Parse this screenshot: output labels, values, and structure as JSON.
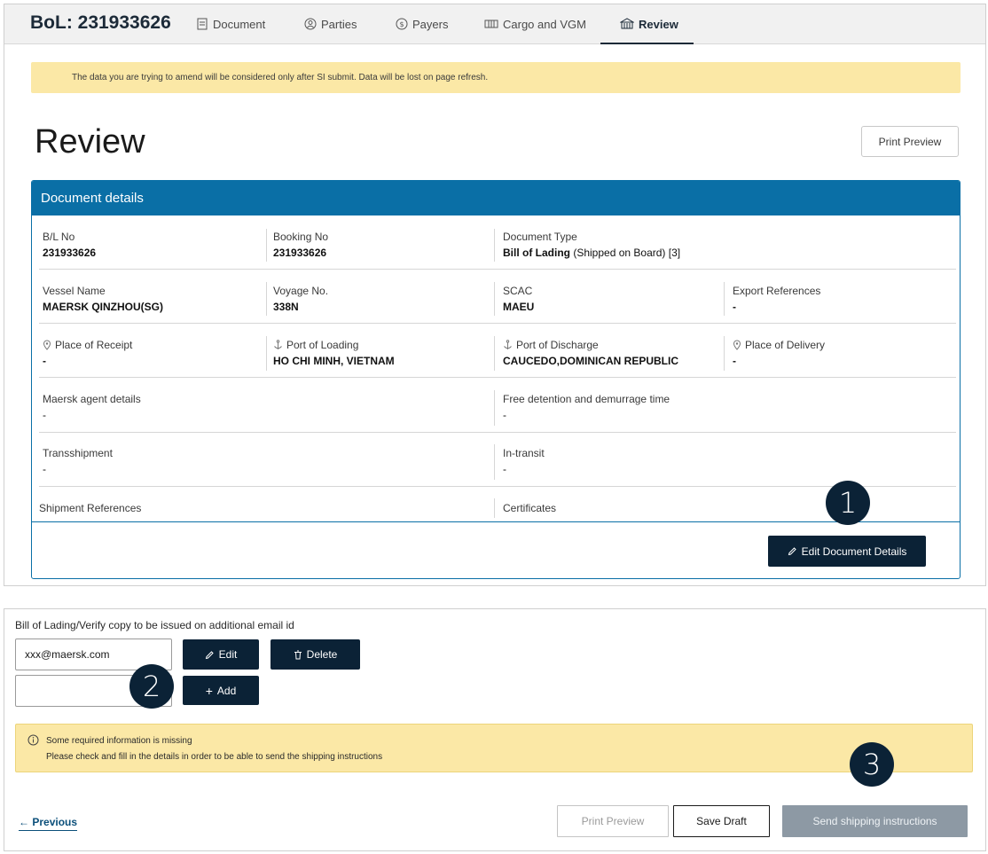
{
  "header": {
    "bol_title": "BoL: 231933626",
    "tabs": [
      {
        "label": "Document",
        "icon": "document-icon"
      },
      {
        "label": "Parties",
        "icon": "user-circle-icon"
      },
      {
        "label": "Payers",
        "icon": "dollar-circle-icon"
      },
      {
        "label": "Cargo and VGM",
        "icon": "container-icon"
      },
      {
        "label": "Review",
        "icon": "building-icon",
        "active": true
      }
    ]
  },
  "banner": {
    "text": "The data you are trying to amend will be considered only after SI submit. Data will be lost on page refresh."
  },
  "page": {
    "title": "Review",
    "print_preview_label": "Print Preview"
  },
  "document_details": {
    "heading": "Document details",
    "bl_no": {
      "label": "B/L No",
      "value": "231933626"
    },
    "booking_no": {
      "label": "Booking No",
      "value": "231933626"
    },
    "document_type": {
      "label": "Document Type",
      "value_bold": "Bill of Lading",
      "value_rest": " (Shipped on Board) [3]"
    },
    "vessel_name": {
      "label": "Vessel Name",
      "value": "MAERSK QINZHOU(SG)"
    },
    "voyage_no": {
      "label": "Voyage No.",
      "value": "338N"
    },
    "scac": {
      "label": "SCAC",
      "value": "MAEU"
    },
    "export_references": {
      "label": "Export References",
      "value": "-"
    },
    "place_of_receipt": {
      "label": "Place of Receipt",
      "value": "-"
    },
    "port_of_loading": {
      "label": "Port of Loading",
      "value": "HO CHI MINH, VIETNAM"
    },
    "port_of_discharge": {
      "label": "Port of Discharge",
      "value": "CAUCEDO,DOMINICAN REPUBLIC"
    },
    "place_of_delivery": {
      "label": "Place of Delivery",
      "value": "-"
    },
    "agent_details": {
      "label": "Maersk agent details",
      "value": "-"
    },
    "free_detention": {
      "label": "Free detention and demurrage time",
      "value": "-"
    },
    "transshipment": {
      "label": "Transshipment",
      "value": "-"
    },
    "in_transit": {
      "label": "In-transit",
      "value": "-"
    },
    "shipment_references": {
      "label": "Shipment References"
    },
    "certificates": {
      "label": "Certificates"
    },
    "edit_button_label": "Edit Document Details"
  },
  "email_section": {
    "label": "Bill of Lading/Verify copy to be issued on additional email id",
    "email_value": "xxx@maersk.com",
    "new_email_value": "",
    "edit_label": "Edit",
    "delete_label": "Delete",
    "add_label": "Add"
  },
  "warning": {
    "line1": "Some required information is missing",
    "line2": "Please check and fill in the details in order to be able to send the shipping instructions"
  },
  "footer": {
    "previous_label": "Previous",
    "print_preview_label": "Print Preview",
    "save_draft_label": "Save Draft",
    "send_label": "Send shipping instructions"
  },
  "step_badges": [
    "1",
    "2",
    "3"
  ],
  "colors": {
    "primary": "#0a6fa6",
    "dark": "#0b2236",
    "banner": "#fbe8a6",
    "disabled": "#8d99a4"
  }
}
